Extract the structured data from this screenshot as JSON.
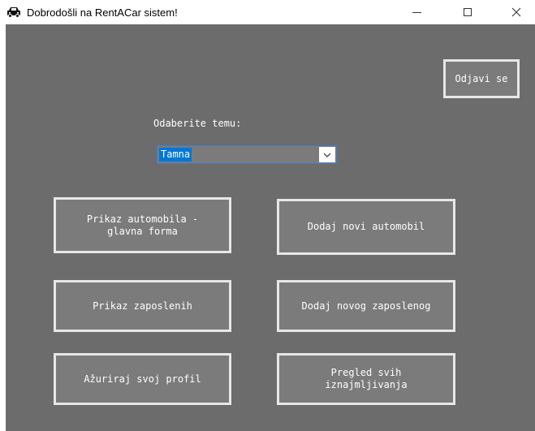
{
  "window": {
    "title": "Dobrodošli na RentACar sistem!",
    "controls": {
      "minimize": "–",
      "close": "✕"
    }
  },
  "header": {
    "logout_label": "Odjavi se"
  },
  "theme": {
    "label": "Odaberite temu:",
    "selected": "Tamna"
  },
  "buttons": {
    "show_cars": "Prikaz automobila -\nglavna forma",
    "add_car": "Dodaj novi automobil",
    "show_employees": "Prikaz zaposlenih",
    "add_employee": "Dodaj novog zaposlenog",
    "update_profile": "Ažuriraj svoj profil",
    "view_rentals": "Pregled svih\niznajmljivanja"
  },
  "colors": {
    "background": "#6c6c6c",
    "button_fill": "#7b7b7b",
    "button_border": "#e7e7e7",
    "selection": "#0078d7"
  }
}
